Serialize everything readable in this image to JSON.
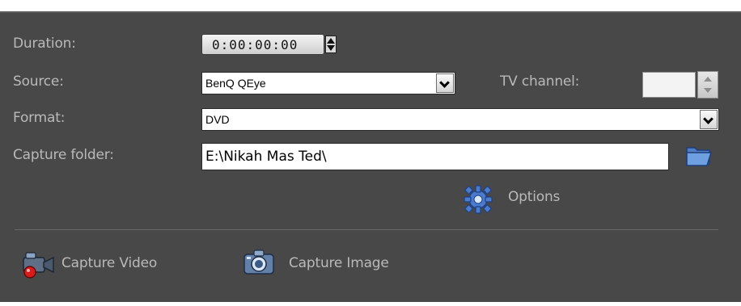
{
  "fields": {
    "duration_label": "Duration:",
    "duration_value": "0:00:00:00",
    "source_label": "Source:",
    "source_value": "BenQ QEye",
    "tv_channel_label": "TV channel:",
    "tv_channel_value": "",
    "format_label": "Format:",
    "format_value": "DVD",
    "capture_folder_label": "Capture folder:",
    "capture_folder_value": "E:\\Nikah Mas Ted\\"
  },
  "actions": {
    "options_label": "Options",
    "capture_video_label": "Capture Video",
    "capture_image_label": "Capture Image"
  },
  "icons": {
    "options": "gear-icon",
    "folder": "folder-icon",
    "capture_video": "video-camera-icon",
    "capture_image": "camera-icon"
  }
}
